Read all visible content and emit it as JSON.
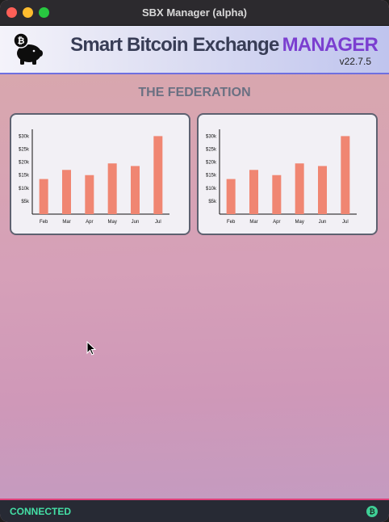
{
  "window": {
    "title": "SBX Manager (alpha)"
  },
  "header": {
    "title_main": "Smart Bitcoin Exchange",
    "title_accent": "MANAGER",
    "version": "v22.7.5",
    "logo_icon": "bitcoin-piggy-bank-icon",
    "accent_color": "#7b3fd0"
  },
  "main": {
    "section_title": "THE FEDERATION"
  },
  "chart_data": [
    {
      "type": "bar",
      "categories": [
        "Feb",
        "Mar",
        "Apr",
        "May",
        "Jun",
        "Jul"
      ],
      "values": [
        13500,
        17000,
        15000,
        19500,
        18500,
        30000
      ],
      "y_ticks": [
        "$5k",
        "$10k",
        "$15k",
        "$20k",
        "$25k",
        "$30k"
      ],
      "ylim": [
        0,
        32000
      ],
      "bar_color": "#f08672",
      "grid": false,
      "legend": false
    },
    {
      "type": "bar",
      "categories": [
        "Feb",
        "Mar",
        "Apr",
        "May",
        "Jun",
        "Jul"
      ],
      "values": [
        13500,
        17000,
        15000,
        19500,
        18500,
        30000
      ],
      "y_ticks": [
        "$5k",
        "$10k",
        "$15k",
        "$20k",
        "$25k",
        "$30k"
      ],
      "ylim": [
        0,
        32000
      ],
      "bar_color": "#f08672",
      "grid": false,
      "legend": false
    }
  ],
  "statusbar": {
    "status": "CONNECTED",
    "status_color": "#44e0a6",
    "icon": "bitcoin-status-icon",
    "icon_glyph": "₿"
  }
}
